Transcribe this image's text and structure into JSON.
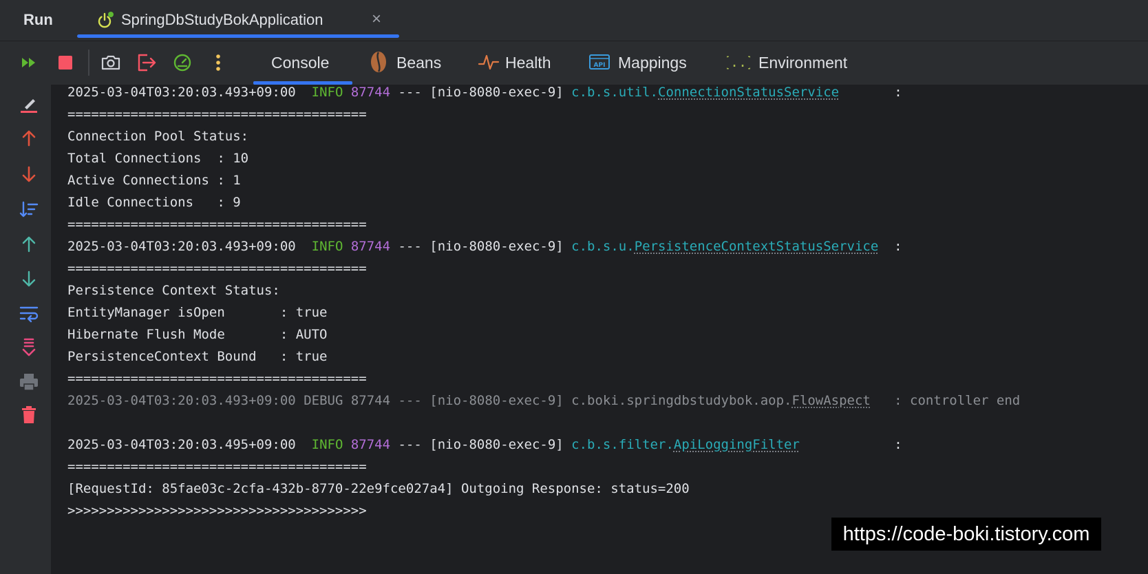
{
  "run_panel": {
    "title": "Run",
    "tab": {
      "label": "SpringDbStudyBokApplication",
      "close": "×"
    }
  },
  "toolbar": {
    "icons": [
      "rerun-icon",
      "stop-icon",
      "camera-icon",
      "exit-icon",
      "dashboard-icon",
      "more-icon"
    ],
    "tabs": [
      {
        "label": "Console",
        "icon": "console",
        "active": true
      },
      {
        "label": "Beans",
        "icon": "coffee-bean-icon",
        "active": false
      },
      {
        "label": "Health",
        "icon": "pulse-icon",
        "active": false
      },
      {
        "label": "Mappings",
        "icon": "api-icon",
        "active": false
      },
      {
        "label": "Environment",
        "icon": "braces-icon",
        "active": false
      }
    ]
  },
  "gutter": {
    "icons": [
      "clear-icon",
      "up-red-icon",
      "down-red-icon",
      "sort-icon",
      "scroll-up-icon",
      "scroll-down-icon",
      "soft-wrap-icon",
      "scroll-to-end-icon",
      "print-icon",
      "trash-icon"
    ]
  },
  "console": {
    "log1": {
      "time": "2025-03-04T03:20:03.493+09:00",
      "level": " INFO",
      "pid": "87744",
      "sep": " --- ",
      "thread": "[nio-8080-exec-9]",
      "logger_pkg": "c.b.s.util.",
      "logger_cls": "ConnectionStatusService",
      "msg": "       :"
    },
    "sep1": "======================================",
    "pool_title": "Connection Pool Status:",
    "pool_total": "Total Connections  : 10",
    "pool_active": "Active Connections : 1",
    "pool_idle": "Idle Connections   : 9",
    "sep2": "======================================",
    "log2": {
      "time": "2025-03-04T03:20:03.493+09:00",
      "level": " INFO",
      "pid": "87744",
      "sep": " --- ",
      "thread": "[nio-8080-exec-9]",
      "logger_pkg": "c.b.s.u.",
      "logger_cls": "PersistenceContextStatusService",
      "msg": "  :"
    },
    "sep3": "======================================",
    "pc_title": "Persistence Context Status:",
    "pc_open": "EntityManager isOpen       : true",
    "pc_flush": "Hibernate Flush Mode       : AUTO",
    "pc_bound": "PersistenceContext Bound   : true",
    "sep4": "======================================",
    "log3": {
      "time": "2025-03-04T03:20:03.493+09:00",
      "level": "DEBUG",
      "pid": "87744",
      "sep": " --- ",
      "thread": "[nio-8080-exec-9]",
      "logger_pkg": "c.boki.springdbstudybok.aop.",
      "logger_cls": "FlowAspect",
      "msg": "   : controller end"
    },
    "log4": {
      "time": "2025-03-04T03:20:03.495+09:00",
      "level": " INFO",
      "pid": "87744",
      "sep": " --- ",
      "thread": "[nio-8080-exec-9]",
      "logger_pkg": "c.b.s.filter.",
      "logger_cls": "ApiLoggingFilter",
      "msg": "            :"
    },
    "sep5": "======================================",
    "response": "[RequestId: 85fae03c-2cfa-432b-8770-22e9fce027a4] Outgoing Response: status=200",
    "sep6": ">>>>>>>>>>>>>>>>>>>>>>>>>>>>>>>>>>>>>>"
  },
  "watermark": "https://code-boki.tistory.com",
  "colors": {
    "accent": "#3574f0",
    "info": "#5fb832",
    "pid": "#b36ed8",
    "logger": "#2aacb8",
    "stop": "#f75464"
  }
}
